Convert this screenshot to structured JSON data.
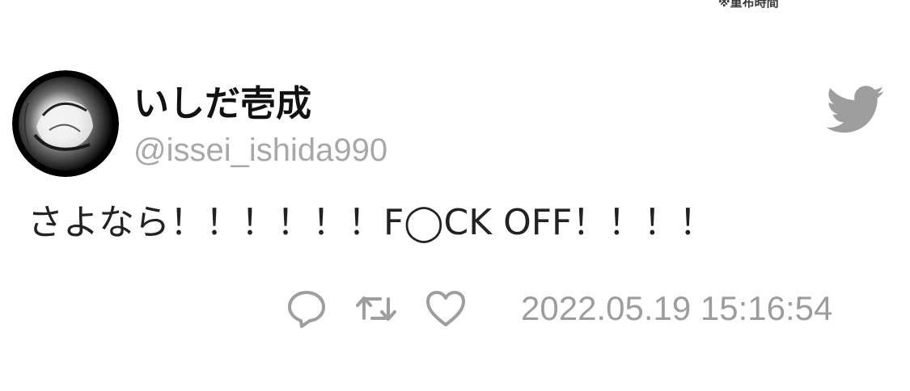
{
  "header_note": "※重布時間",
  "author": {
    "display_name": "いしだ壱成",
    "handle": "@issei_ishida990"
  },
  "tweet": {
    "text": "さよなら！！！！！！F◯CK OFF！！！！",
    "timestamp": "2022.05.19 15:16:54"
  },
  "icons": {
    "platform": "twitter-bird-icon",
    "reply": "reply-icon",
    "retweet": "retweet-icon",
    "like": "like-icon"
  },
  "colors": {
    "icon_gray": "#9e9e9e",
    "text_dark": "#222222",
    "handle_gray": "#a8a8a8"
  }
}
